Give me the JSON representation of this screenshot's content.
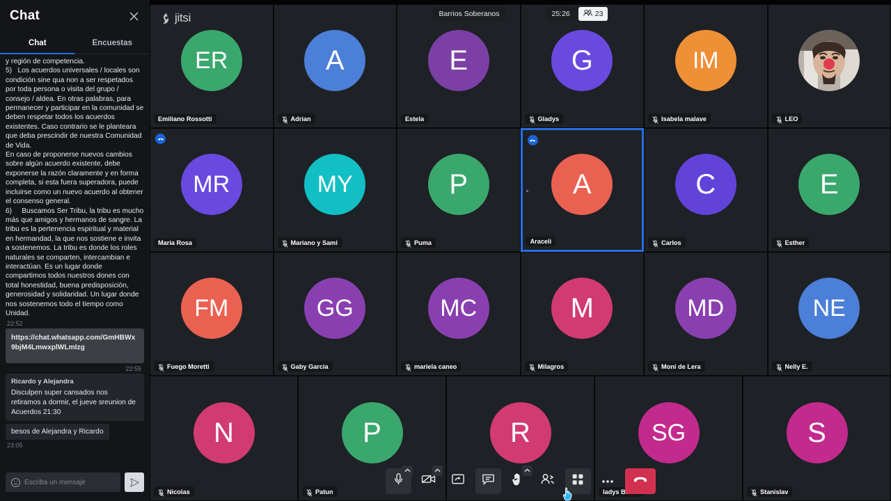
{
  "chat": {
    "title": "Chat",
    "close_icon": "close-icon",
    "tabs": [
      {
        "label": "Chat",
        "active": true
      },
      {
        "label": "Encuestas",
        "active": false
      }
    ],
    "messages": [
      {
        "kind": "plain",
        "text": "y región de competencia.\n5)   Los acuerdos universales / locales son condición sine qua non a ser respetados por toda persona o visita del grupo / consejo / aldea. En otras palabras, para permanecer y participar en la comunidad se deben respetar todos los acuerdos existentes. Caso contrario se le planteara que deba prescindir de nuestra Comunidad de Vida.\nEn caso de proponerse nuevos cambios sobre algún acuerdo existente, debe exponerse la razón claramente y en forma completa, si esta fuera superadora, puede incluirse como un nuevo acuerdo al obtener el consenso general.\n6)     Buscamos Ser Tribu, la tribu es mucho más que amigos y hermanos de sangre. La tribu es la pertenencia espiritual y material en hermandad, la que nos sostiene e invita a sostenemos. La tribu es donde los roles naturales se comparten, intercambian e interactúan. Es un lugar donde compartimos todos nuestros dones con total honestidad, buena predisposición, generosidad y solidaridad. Un lugar donde nos sostenemos todo el tiempo como Unidad."
      },
      {
        "kind": "time",
        "text": "22:52"
      },
      {
        "kind": "bubble_link",
        "text": "https://chat.whatsapp.com/GmHBWx9bjM4LmwxplWLmIzg"
      },
      {
        "kind": "time_right",
        "text": "22:55"
      },
      {
        "kind": "bubble_in",
        "name": "Ricardo y Alejandra",
        "text": "Disculpen super cansados  nos retiramos a dormir, el jueve sreunion de Acuerdos 21:30"
      },
      {
        "kind": "bubble_short",
        "text": "besos de Alejandra y Ricardo"
      },
      {
        "kind": "time",
        "text": "23:05"
      }
    ],
    "input": {
      "placeholder": "Escriba un mensaje",
      "value": "",
      "emoji_icon": "smiley-icon",
      "send_icon": "send-icon"
    }
  },
  "branding": {
    "logo_text": "jitsi",
    "logo_icon": "jitsi-logo-icon"
  },
  "topbar": {
    "subject": "Barrios Soberanos",
    "timer": "25:26",
    "participant_count": "23",
    "participants_icon": "people-icon"
  },
  "colors": {
    "accent_blue": "#246fe5",
    "hangup_red": "#d1314f",
    "tile_bg": "#1e2126"
  },
  "participants": [
    {
      "name": "Emiliano Rossotti",
      "initials": "ER",
      "color": "#3aa76d",
      "muted": false,
      "active": false,
      "badge": false,
      "photo": false
    },
    {
      "name": "Adrian",
      "initials": "A",
      "color": "#4b7fd8",
      "muted": true,
      "active": false,
      "badge": false,
      "photo": false
    },
    {
      "name": "Estela",
      "initials": "E",
      "color": "#7b3fa5",
      "muted": false,
      "active": false,
      "badge": false,
      "photo": false
    },
    {
      "name": "Gladys",
      "initials": "G",
      "color": "#6949e0",
      "muted": true,
      "active": false,
      "badge": false,
      "photo": false
    },
    {
      "name": "Isabela malave",
      "initials": "IM",
      "color": "#ef8f36",
      "muted": true,
      "active": false,
      "badge": false,
      "photo": false
    },
    {
      "name": "LEO",
      "initials": "",
      "color": "#8a7f78",
      "muted": true,
      "active": false,
      "badge": false,
      "photo": true
    },
    {
      "name": "Maria Rosa",
      "initials": "MR",
      "color": "#6949e0",
      "muted": false,
      "active": false,
      "badge": true,
      "photo": false
    },
    {
      "name": "Mariano y Sami",
      "initials": "MY",
      "color": "#11bfc4",
      "muted": true,
      "active": false,
      "badge": false,
      "photo": false
    },
    {
      "name": "Puma",
      "initials": "P",
      "color": "#3aa76d",
      "muted": true,
      "active": false,
      "badge": false,
      "photo": false
    },
    {
      "name": "Araceli",
      "initials": "A",
      "color": "#ea6152",
      "muted": false,
      "active": true,
      "badge": true,
      "photo": false
    },
    {
      "name": "Carlos",
      "initials": "C",
      "color": "#6143da",
      "muted": true,
      "active": false,
      "badge": false,
      "photo": false
    },
    {
      "name": "Esther",
      "initials": "E",
      "color": "#3aa76d",
      "muted": true,
      "active": false,
      "badge": false,
      "photo": false
    },
    {
      "name": "Fuego Moretti",
      "initials": "FM",
      "color": "#ea6152",
      "muted": true,
      "active": false,
      "badge": false,
      "photo": false
    },
    {
      "name": "Gaby Garcia",
      "initials": "GG",
      "color": "#8a3fb0",
      "muted": true,
      "active": false,
      "badge": false,
      "photo": false
    },
    {
      "name": "mariela caneo",
      "initials": "MC",
      "color": "#8a3fb0",
      "muted": true,
      "active": false,
      "badge": false,
      "photo": false
    },
    {
      "name": "Milagros",
      "initials": "M",
      "color": "#d23a72",
      "muted": true,
      "active": false,
      "badge": false,
      "photo": false
    },
    {
      "name": "Moni de Lera",
      "initials": "MD",
      "color": "#8a3fb0",
      "muted": true,
      "active": false,
      "badge": false,
      "photo": false
    },
    {
      "name": "Nelly E.",
      "initials": "NE",
      "color": "#4b7fd8",
      "muted": true,
      "active": false,
      "badge": false,
      "photo": false
    },
    {
      "name": "Nicolas",
      "initials": "N",
      "color": "#d23a72",
      "muted": true,
      "active": false,
      "badge": false,
      "photo": false
    },
    {
      "name": "Patun",
      "initials": "P",
      "color": "#3aa76d",
      "muted": true,
      "active": false,
      "badge": false,
      "photo": false
    },
    {
      "name": "",
      "initials": "R",
      "color": "#d23a72",
      "muted": false,
      "active": false,
      "badge": false,
      "photo": false
    },
    {
      "name": "ladys Bruno",
      "initials": "SG",
      "color": "#c32a8e",
      "muted": false,
      "active": false,
      "badge": false,
      "photo": false
    },
    {
      "name": "Stanislav",
      "initials": "S",
      "color": "#c32a8e",
      "muted": true,
      "active": false,
      "badge": false,
      "photo": false
    }
  ],
  "toolbar": [
    {
      "name": "microphone-button",
      "icon": "microphone-icon",
      "shaded": true,
      "caret": true,
      "hangup": false
    },
    {
      "name": "camera-button",
      "icon": "camera-off-icon",
      "shaded": false,
      "caret": true,
      "hangup": false
    },
    {
      "name": "screen-share-button",
      "icon": "screen-share-icon",
      "shaded": false,
      "caret": false,
      "hangup": false
    },
    {
      "name": "chat-button",
      "icon": "chat-icon",
      "shaded": true,
      "caret": false,
      "hangup": false
    },
    {
      "name": "raise-hand-button",
      "icon": "raise-hand-icon",
      "shaded": false,
      "caret": true,
      "hangup": false
    },
    {
      "name": "participants-button",
      "icon": "participants-icon",
      "shaded": false,
      "caret": false,
      "hangup": false
    },
    {
      "name": "tile-view-button",
      "icon": "tile-view-icon",
      "shaded": true,
      "caret": false,
      "hangup": false
    },
    {
      "name": "more-options-button",
      "icon": "more-icon",
      "shaded": false,
      "caret": false,
      "hangup": false
    },
    {
      "name": "hangup-button",
      "icon": "hangup-icon",
      "shaded": false,
      "caret": false,
      "hangup": true
    }
  ]
}
